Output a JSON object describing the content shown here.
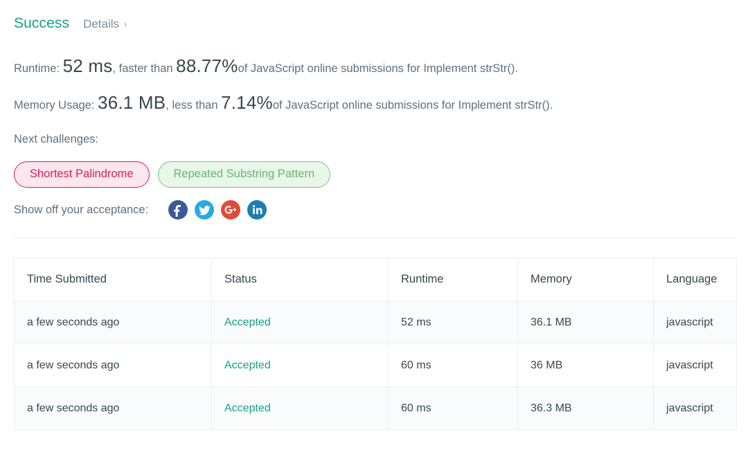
{
  "header": {
    "status_title": "Success",
    "details_label": "Details",
    "chevron": "›"
  },
  "runtime_line": {
    "label": "Runtime:",
    "value": "52 ms",
    "mid": ", faster than",
    "percent": "88.77%",
    "tail": "of JavaScript online submissions for Implement strStr()."
  },
  "memory_line": {
    "label": "Memory Usage:",
    "value": "36.1 MB",
    "mid": ", less than",
    "percent": "7.14%",
    "tail": "of JavaScript online submissions for Implement strStr()."
  },
  "next_challenges": {
    "label": "Next challenges:",
    "pills": [
      {
        "text": "Shortest Palindrome",
        "style": "pink",
        "border_color": "#d81b60",
        "bg_color": "#fce7ee"
      },
      {
        "text": "Repeated Substring Pattern",
        "style": "green",
        "border_color": "#76c47a",
        "bg_color": "#e9f6ea"
      }
    ]
  },
  "share": {
    "label": "Show off your acceptance:",
    "icons": [
      {
        "name": "facebook-icon",
        "glyph": "f",
        "color": "#3b5998"
      },
      {
        "name": "twitter-icon",
        "glyph": "t",
        "color": "#29a9e1"
      },
      {
        "name": "google-plus-icon",
        "glyph": "G+",
        "color": "#e04b39"
      },
      {
        "name": "linkedin-icon",
        "glyph": "in",
        "color": "#1d7eb0"
      }
    ]
  },
  "submissions_table": {
    "columns": [
      "Time Submitted",
      "Status",
      "Runtime",
      "Memory",
      "Language"
    ],
    "rows": [
      {
        "time": "a few seconds ago",
        "status": "Accepted",
        "runtime": "52 ms",
        "memory": "36.1 MB",
        "language": "javascript"
      },
      {
        "time": "a few seconds ago",
        "status": "Accepted",
        "runtime": "60 ms",
        "memory": "36 MB",
        "language": "javascript"
      },
      {
        "time": "a few seconds ago",
        "status": "Accepted",
        "runtime": "60 ms",
        "memory": "36.3 MB",
        "language": "javascript"
      }
    ]
  },
  "colors": {
    "accent_teal": "#16a085",
    "text_primary": "#37474f",
    "text_muted": "#5c7080",
    "border": "#edeff1"
  }
}
